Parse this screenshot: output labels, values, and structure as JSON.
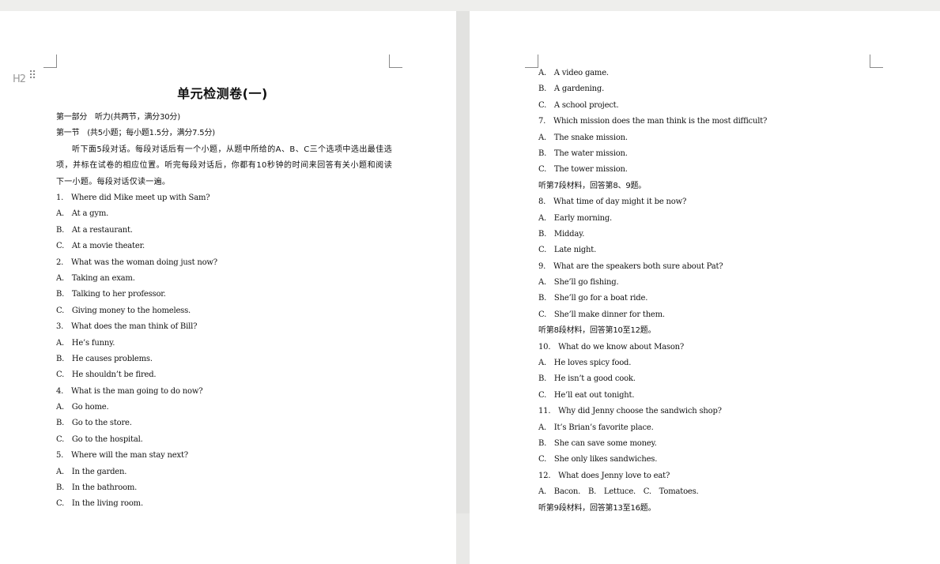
{
  "document": {
    "title": "单元检测卷(一)",
    "heading_tool_label": "H2",
    "drag_handle_glyph": "⠿",
    "left_column": [
      {
        "text": "第一部分　听力(共两节，满分30分)",
        "cjk": true
      },
      {
        "text": "第一节　(共5小题；每小题1.5分，满分7.5分)",
        "cjk": true
      },
      {
        "text": "听下面5段对话。每段对话后有一个小题，从题中所给的A、B、C三个选项中选出最佳选项，并标在试卷的相应位置。听完每段对话后，你都有10秒钟的时间来回答有关小题和阅读下一小题。每段对话仅读一遍。",
        "para": true
      },
      {
        "text": "1.　Where did Mike meet up with Sam?"
      },
      {
        "text": "A.　At a gym."
      },
      {
        "text": "B.　At a restaurant."
      },
      {
        "text": "C.　At a movie theater."
      },
      {
        "text": "2.　What was the woman doing just now?"
      },
      {
        "text": "A.　Taking an exam."
      },
      {
        "text": "B.　Talking to her professor."
      },
      {
        "text": "C.　Giving money to the homeless."
      },
      {
        "text": "3.　What does the man think of Bill?"
      },
      {
        "text": "A.　He’s funny."
      },
      {
        "text": "B.　He causes problems."
      },
      {
        "text": "C.　He shouldn’t be fired."
      },
      {
        "text": "4.　What is the man going to do now?"
      },
      {
        "text": "A.　Go home."
      },
      {
        "text": "B.　Go to the store."
      },
      {
        "text": "C.　Go to the hospital."
      },
      {
        "text": "5.　Where will the man stay next?"
      },
      {
        "text": "A.　In the garden."
      },
      {
        "text": "B.　In the bathroom."
      },
      {
        "text": "C.　In the living room."
      }
    ],
    "right_column": [
      {
        "text": "A.　A video game."
      },
      {
        "text": "B.　A gardening."
      },
      {
        "text": "C.　A school project."
      },
      {
        "text": "7.　Which mission does the man think is the most difficult?"
      },
      {
        "text": "A.　The snake mission."
      },
      {
        "text": "B.　The water mission."
      },
      {
        "text": "C.　The tower mission."
      },
      {
        "text": "听第7段材料，回答第8、9题。",
        "cjk": true
      },
      {
        "text": "8.　What time of day might it be now?"
      },
      {
        "text": "A.　Early morning."
      },
      {
        "text": "B.　Midday."
      },
      {
        "text": "C.　Late night."
      },
      {
        "text": "9.　What are the speakers both sure about Pat?"
      },
      {
        "text": "A.　She’ll go fishing."
      },
      {
        "text": "B.　She’ll go for a boat ride."
      },
      {
        "text": "C.　She’ll make dinner for them."
      },
      {
        "text": "听第8段材料，回答第10至12题。",
        "cjk": true
      },
      {
        "text": "10.　What do we know about Mason?"
      },
      {
        "text": "A.　He loves spicy food."
      },
      {
        "text": "B.　He isn’t a good cook."
      },
      {
        "text": "C.　He’ll eat out tonight."
      },
      {
        "text": "11.　Why did Jenny choose the sandwich shop?"
      },
      {
        "text": "A.　It’s Brian’s favorite place."
      },
      {
        "text": "B.　She can save some money."
      },
      {
        "text": "C.　She only likes sandwiches."
      },
      {
        "text": "12.　What does Jenny love to eat?"
      },
      {
        "text": "A.　Bacon.　B.　Lettuce.　C.　Tomatoes."
      },
      {
        "text": "听第9段材料，回答第13至16题。",
        "cjk": true
      }
    ]
  }
}
